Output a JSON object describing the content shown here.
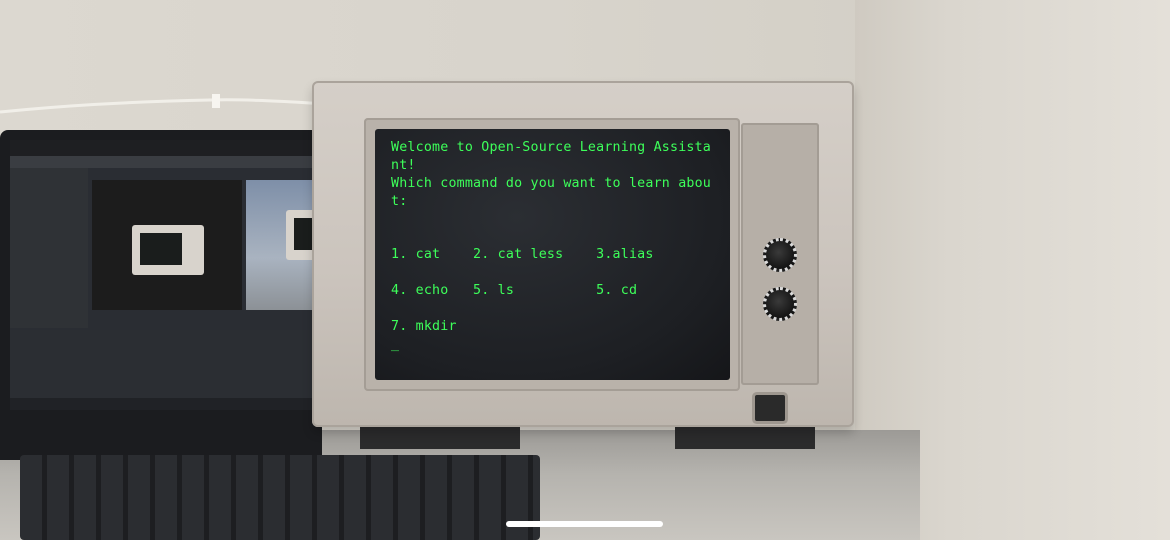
{
  "terminal": {
    "lines": [
      "Welcome to Open-Source Learning Assista",
      "nt!",
      "Which command do you want to learn abou",
      "t:",
      "",
      "",
      "1. cat    2. cat less    3.alias",
      "",
      "4. echo   5. ls          5. cd",
      "",
      "7. mkdir",
      "_"
    ],
    "text_color": "#3dff5a",
    "background_color": "#1d1f23"
  },
  "monitor": {
    "icons": [
      "knob-top",
      "knob-bottom",
      "power-button"
    ]
  }
}
